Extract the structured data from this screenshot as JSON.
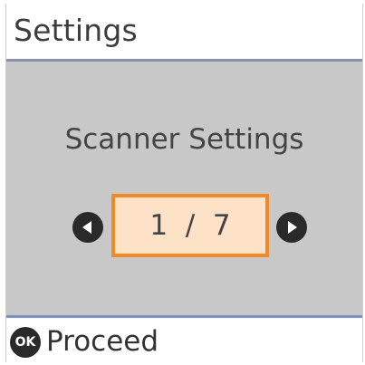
{
  "header": {
    "title": "Settings"
  },
  "content": {
    "heading": "Scanner Settings",
    "pager": {
      "current": 1,
      "total": 7,
      "display": "1  /  7",
      "prev_icon": "circle-arrow-left-icon",
      "next_icon": "circle-arrow-right-icon"
    }
  },
  "footer": {
    "ok_icon_text": "OK",
    "proceed_label": "Proceed"
  },
  "colors": {
    "title_rule": "#7f8fbf",
    "content_bg": "#c8c8c8",
    "page_box_fill": "#fde2c8",
    "page_box_border": "#f08a24",
    "icon_dark": "#2a2a2a"
  }
}
